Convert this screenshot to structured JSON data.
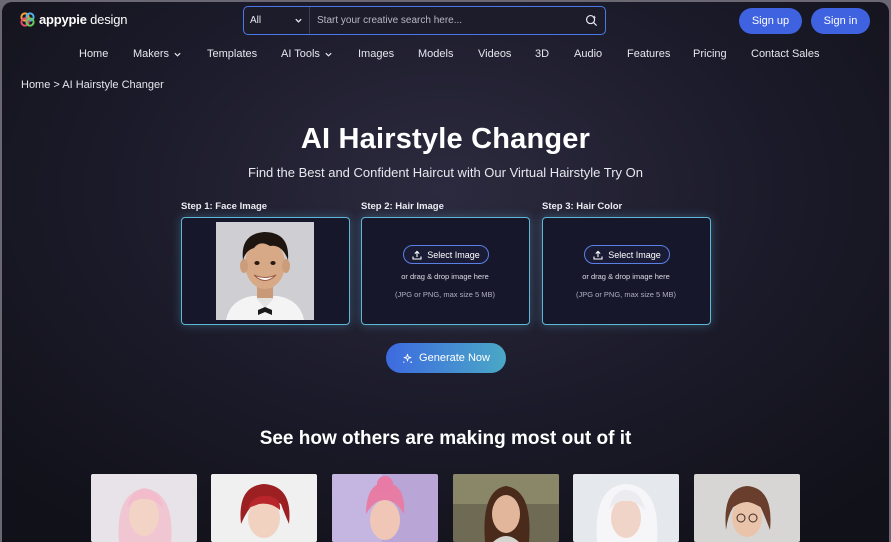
{
  "header": {
    "logo_brand": "appypie",
    "logo_suffix": " design",
    "search": {
      "category": "All",
      "placeholder": "Start your creative search here..."
    },
    "signup_label": "Sign up",
    "signin_label": "Sign in"
  },
  "nav": {
    "items": [
      {
        "label": "Home"
      },
      {
        "label": "Makers"
      },
      {
        "label": "Templates"
      },
      {
        "label": "AI Tools"
      },
      {
        "label": "Images"
      },
      {
        "label": "Models"
      },
      {
        "label": "Videos"
      },
      {
        "label": "3D"
      },
      {
        "label": "Audio"
      },
      {
        "label": "Features"
      },
      {
        "label": "Pricing"
      },
      {
        "label": "Contact Sales"
      }
    ]
  },
  "breadcrumb": "Home > AI Hairstyle Changer",
  "hero": {
    "title": "AI Hairstyle Changer",
    "subtitle": "Find the Best and Confident Haircut with Our Virtual Hairstyle Try On"
  },
  "steps": [
    {
      "label": "Step 1: Face Image"
    },
    {
      "label": "Step 2: Hair Image",
      "button": "Select Image",
      "drag": "or drag & drop image here",
      "size": "(JPG or PNG, max size 5 MB)"
    },
    {
      "label": "Step 3: Hair Color",
      "button": "Select Image",
      "drag": "or drag & drop image here",
      "size": "(JPG or PNG, max size 5 MB)"
    }
  ],
  "generate_label": "Generate Now",
  "gallery_title": "See how others are making most out of it",
  "colors": {
    "accent": "#3f62e0",
    "border_glow": "#5fb7d8"
  }
}
